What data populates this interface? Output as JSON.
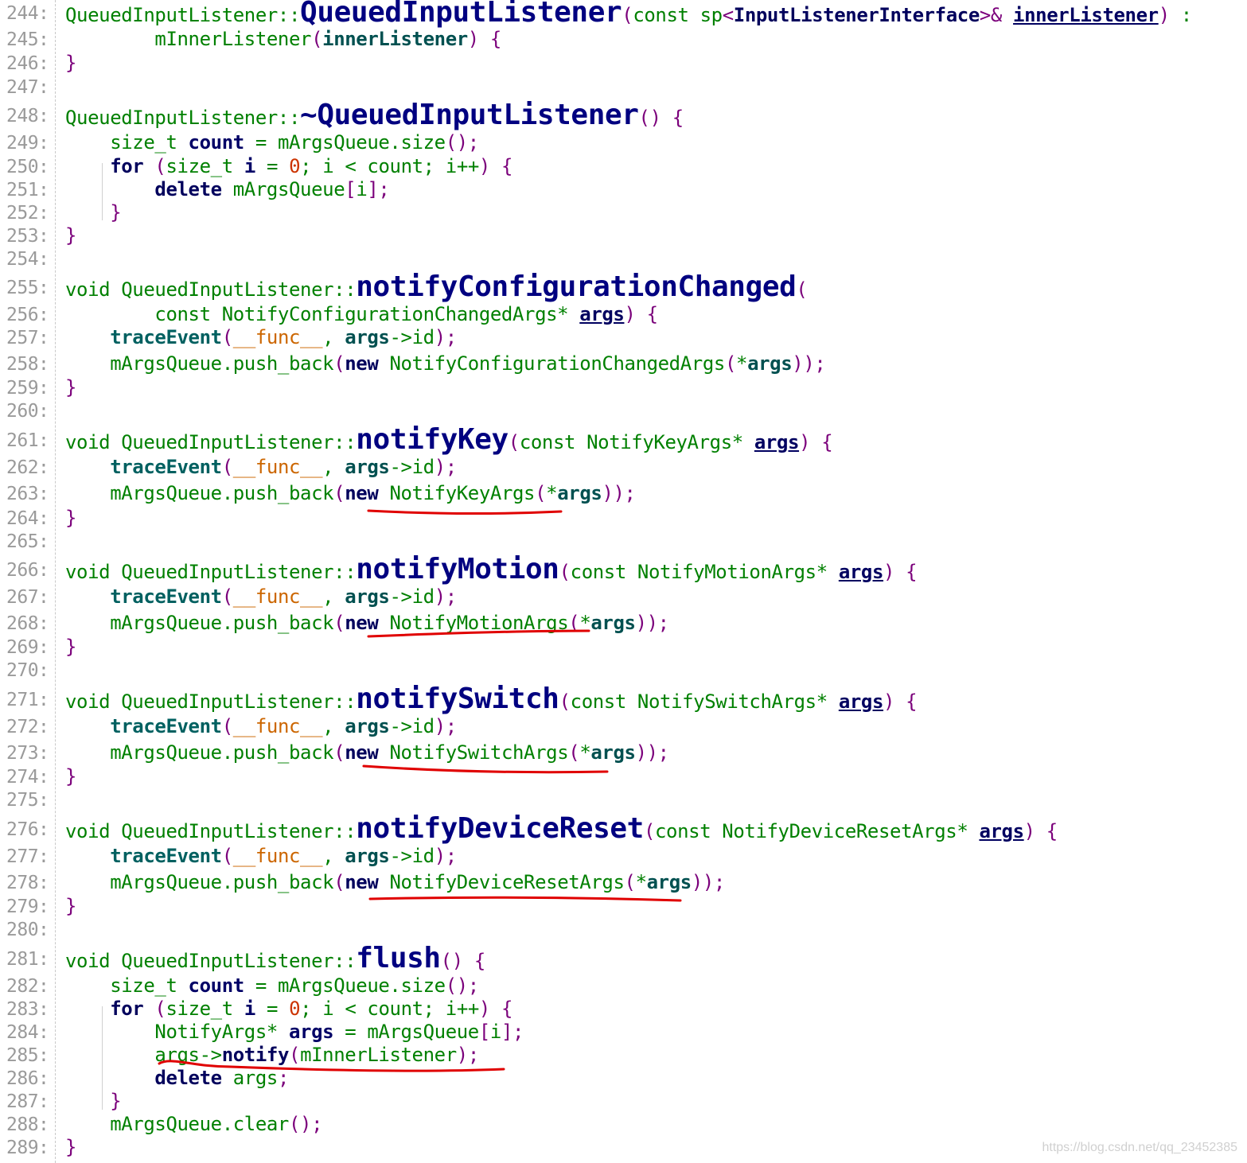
{
  "editor": {
    "lines": [
      {
        "n": "244:",
        "tokens": [
          [
            "plain",
            "QueuedInputListener::"
          ],
          [
            "defname",
            "QueuedInputListener"
          ],
          [
            "punc",
            "("
          ],
          [
            "kwlite",
            "const sp"
          ],
          [
            "punc",
            "<"
          ],
          [
            "kw",
            "InputListenerInterface"
          ],
          [
            "punc",
            ">&"
          ],
          [
            "plain",
            " "
          ],
          [
            "paramdecl",
            "innerListener"
          ],
          [
            "punc",
            ")"
          ],
          [
            "plain",
            " :"
          ]
        ]
      },
      {
        "n": "245:",
        "tokens": [
          [
            "plain",
            "        mInnerListener"
          ],
          [
            "punc",
            "("
          ],
          [
            "param",
            "innerListener"
          ],
          [
            "punc",
            ")"
          ],
          [
            "plain",
            " "
          ],
          [
            "punc",
            "{"
          ]
        ]
      },
      {
        "n": "246:",
        "tokens": [
          [
            "punc",
            "}"
          ]
        ]
      },
      {
        "n": "247:",
        "tokens": []
      },
      {
        "n": "248:",
        "tokens": [
          [
            "plain",
            "QueuedInputListener::"
          ],
          [
            "defname",
            "~QueuedInputListener"
          ],
          [
            "punc",
            "()"
          ],
          [
            "plain",
            " "
          ],
          [
            "punc",
            "{"
          ]
        ]
      },
      {
        "n": "249:",
        "tokens": [
          [
            "plain",
            "    size_t "
          ],
          [
            "var",
            "count"
          ],
          [
            "plain",
            " = mArgsQueue.size"
          ],
          [
            "punc",
            "();"
          ]
        ]
      },
      {
        "n": "250:",
        "tokens": [
          [
            "plain",
            "    "
          ],
          [
            "kw",
            "for"
          ],
          [
            "plain",
            " "
          ],
          [
            "punc",
            "("
          ],
          [
            "plain",
            "size_t "
          ],
          [
            "var",
            "i"
          ],
          [
            "plain",
            " = "
          ],
          [
            "num",
            "0"
          ],
          [
            "plain",
            "; i < count; i++"
          ],
          [
            "punc",
            ")"
          ],
          [
            "plain",
            " "
          ],
          [
            "punc",
            "{"
          ]
        ]
      },
      {
        "n": "251:",
        "tokens": [
          [
            "plain",
            "        "
          ],
          [
            "kw",
            "delete"
          ],
          [
            "plain",
            " mArgsQueue"
          ],
          [
            "punc",
            "["
          ],
          [
            "plain",
            "i"
          ],
          [
            "punc",
            "];"
          ]
        ]
      },
      {
        "n": "252:",
        "tokens": [
          [
            "plain",
            "    "
          ],
          [
            "punc",
            "}"
          ]
        ]
      },
      {
        "n": "253:",
        "tokens": [
          [
            "punc",
            "}"
          ]
        ]
      },
      {
        "n": "254:",
        "tokens": []
      },
      {
        "n": "255:",
        "tokens": [
          [
            "plain",
            "void QueuedInputListener::"
          ],
          [
            "defname",
            "notifyConfigurationChanged"
          ],
          [
            "punc",
            "("
          ]
        ]
      },
      {
        "n": "256:",
        "tokens": [
          [
            "plain",
            "        const NotifyConfigurationChangedArgs* "
          ],
          [
            "paramdecl",
            "args"
          ],
          [
            "punc",
            ")"
          ],
          [
            "plain",
            " "
          ],
          [
            "punc",
            "{"
          ]
        ]
      },
      {
        "n": "257:",
        "tokens": [
          [
            "plain",
            "    "
          ],
          [
            "call",
            "traceEvent"
          ],
          [
            "punc",
            "("
          ],
          [
            "macro",
            "__func__"
          ],
          [
            "plain",
            ", "
          ],
          [
            "param",
            "args"
          ],
          [
            "plain",
            "->id"
          ],
          [
            "punc",
            ");"
          ]
        ]
      },
      {
        "n": "258:",
        "tokens": [
          [
            "plain",
            "    mArgsQueue.push_back"
          ],
          [
            "punc",
            "("
          ],
          [
            "kw",
            "new"
          ],
          [
            "plain",
            " NotifyConfigurationChangedArgs"
          ],
          [
            "punc",
            "("
          ],
          [
            "plain",
            "*"
          ],
          [
            "param",
            "args"
          ],
          [
            "punc",
            "));"
          ]
        ]
      },
      {
        "n": "259:",
        "tokens": [
          [
            "punc",
            "}"
          ]
        ]
      },
      {
        "n": "260:",
        "tokens": []
      },
      {
        "n": "261:",
        "tokens": [
          [
            "plain",
            "void QueuedInputListener::"
          ],
          [
            "defname",
            "notifyKey"
          ],
          [
            "punc",
            "("
          ],
          [
            "plain",
            "const NotifyKeyArgs* "
          ],
          [
            "paramdecl",
            "args"
          ],
          [
            "punc",
            ")"
          ],
          [
            "plain",
            " "
          ],
          [
            "punc",
            "{"
          ]
        ]
      },
      {
        "n": "262:",
        "tokens": [
          [
            "plain",
            "    "
          ],
          [
            "call",
            "traceEvent"
          ],
          [
            "punc",
            "("
          ],
          [
            "macro",
            "__func__"
          ],
          [
            "plain",
            ", "
          ],
          [
            "param",
            "args"
          ],
          [
            "plain",
            "->id"
          ],
          [
            "punc",
            ");"
          ]
        ]
      },
      {
        "n": "263:",
        "tokens": [
          [
            "plain",
            "    mArgsQueue.push_back"
          ],
          [
            "punc",
            "("
          ],
          [
            "kw",
            "new"
          ],
          [
            "plain",
            " NotifyKeyArgs"
          ],
          [
            "punc",
            "("
          ],
          [
            "plain",
            "*"
          ],
          [
            "param",
            "args"
          ],
          [
            "punc",
            "));"
          ]
        ]
      },
      {
        "n": "264:",
        "tokens": [
          [
            "punc",
            "}"
          ]
        ]
      },
      {
        "n": "265:",
        "tokens": []
      },
      {
        "n": "266:",
        "tokens": [
          [
            "plain",
            "void QueuedInputListener::"
          ],
          [
            "defname",
            "notifyMotion"
          ],
          [
            "punc",
            "("
          ],
          [
            "plain",
            "const NotifyMotionArgs* "
          ],
          [
            "paramdecl",
            "args"
          ],
          [
            "punc",
            ")"
          ],
          [
            "plain",
            " "
          ],
          [
            "punc",
            "{"
          ]
        ]
      },
      {
        "n": "267:",
        "tokens": [
          [
            "plain",
            "    "
          ],
          [
            "call",
            "traceEvent"
          ],
          [
            "punc",
            "("
          ],
          [
            "macro",
            "__func__"
          ],
          [
            "plain",
            ", "
          ],
          [
            "param",
            "args"
          ],
          [
            "plain",
            "->id"
          ],
          [
            "punc",
            ");"
          ]
        ]
      },
      {
        "n": "268:",
        "tokens": [
          [
            "plain",
            "    mArgsQueue.push_back"
          ],
          [
            "punc",
            "("
          ],
          [
            "kw",
            "new"
          ],
          [
            "plain",
            " NotifyMotionArgs"
          ],
          [
            "punc",
            "("
          ],
          [
            "plain",
            "*"
          ],
          [
            "param",
            "args"
          ],
          [
            "punc",
            "));"
          ]
        ]
      },
      {
        "n": "269:",
        "tokens": [
          [
            "punc",
            "}"
          ]
        ]
      },
      {
        "n": "270:",
        "tokens": []
      },
      {
        "n": "271:",
        "tokens": [
          [
            "plain",
            "void QueuedInputListener::"
          ],
          [
            "defname",
            "notifySwitch"
          ],
          [
            "punc",
            "("
          ],
          [
            "plain",
            "const NotifySwitchArgs* "
          ],
          [
            "paramdecl",
            "args"
          ],
          [
            "punc",
            ")"
          ],
          [
            "plain",
            " "
          ],
          [
            "punc",
            "{"
          ]
        ]
      },
      {
        "n": "272:",
        "tokens": [
          [
            "plain",
            "    "
          ],
          [
            "call",
            "traceEvent"
          ],
          [
            "punc",
            "("
          ],
          [
            "macro",
            "__func__"
          ],
          [
            "plain",
            ", "
          ],
          [
            "param",
            "args"
          ],
          [
            "plain",
            "->id"
          ],
          [
            "punc",
            ");"
          ]
        ]
      },
      {
        "n": "273:",
        "tokens": [
          [
            "plain",
            "    mArgsQueue.push_back"
          ],
          [
            "punc",
            "("
          ],
          [
            "kw",
            "new"
          ],
          [
            "plain",
            " NotifySwitchArgs"
          ],
          [
            "punc",
            "("
          ],
          [
            "plain",
            "*"
          ],
          [
            "param",
            "args"
          ],
          [
            "punc",
            "));"
          ]
        ]
      },
      {
        "n": "274:",
        "tokens": [
          [
            "punc",
            "}"
          ]
        ]
      },
      {
        "n": "275:",
        "tokens": []
      },
      {
        "n": "276:",
        "tokens": [
          [
            "plain",
            "void QueuedInputListener::"
          ],
          [
            "defname",
            "notifyDeviceReset"
          ],
          [
            "punc",
            "("
          ],
          [
            "plain",
            "const NotifyDeviceResetArgs* "
          ],
          [
            "paramdecl",
            "args"
          ],
          [
            "punc",
            ")"
          ],
          [
            "plain",
            " "
          ],
          [
            "punc",
            "{"
          ]
        ]
      },
      {
        "n": "277:",
        "tokens": [
          [
            "plain",
            "    "
          ],
          [
            "call",
            "traceEvent"
          ],
          [
            "punc",
            "("
          ],
          [
            "macro",
            "__func__"
          ],
          [
            "plain",
            ", "
          ],
          [
            "param",
            "args"
          ],
          [
            "plain",
            "->id"
          ],
          [
            "punc",
            ");"
          ]
        ]
      },
      {
        "n": "278:",
        "tokens": [
          [
            "plain",
            "    mArgsQueue.push_back"
          ],
          [
            "punc",
            "("
          ],
          [
            "kw",
            "new"
          ],
          [
            "plain",
            " NotifyDeviceResetArgs"
          ],
          [
            "punc",
            "("
          ],
          [
            "plain",
            "*"
          ],
          [
            "param",
            "args"
          ],
          [
            "punc",
            "));"
          ]
        ]
      },
      {
        "n": "279:",
        "tokens": [
          [
            "punc",
            "}"
          ]
        ]
      },
      {
        "n": "280:",
        "tokens": []
      },
      {
        "n": "281:",
        "tokens": [
          [
            "plain",
            "void QueuedInputListener::"
          ],
          [
            "defname",
            "flush"
          ],
          [
            "punc",
            "()"
          ],
          [
            "plain",
            " "
          ],
          [
            "punc",
            "{"
          ]
        ]
      },
      {
        "n": "282:",
        "tokens": [
          [
            "plain",
            "    size_t "
          ],
          [
            "var",
            "count"
          ],
          [
            "plain",
            " = mArgsQueue.size"
          ],
          [
            "punc",
            "();"
          ]
        ]
      },
      {
        "n": "283:",
        "tokens": [
          [
            "plain",
            "    "
          ],
          [
            "kw",
            "for"
          ],
          [
            "plain",
            " "
          ],
          [
            "punc",
            "("
          ],
          [
            "plain",
            "size_t "
          ],
          [
            "var",
            "i"
          ],
          [
            "plain",
            " = "
          ],
          [
            "num",
            "0"
          ],
          [
            "plain",
            "; i < count; i++"
          ],
          [
            "punc",
            ")"
          ],
          [
            "plain",
            " "
          ],
          [
            "punc",
            "{"
          ]
        ]
      },
      {
        "n": "284:",
        "tokens": [
          [
            "plain",
            "        NotifyArgs* "
          ],
          [
            "var",
            "args"
          ],
          [
            "plain",
            " = mArgsQueue"
          ],
          [
            "punc",
            "["
          ],
          [
            "plain",
            "i"
          ],
          [
            "punc",
            "];"
          ]
        ]
      },
      {
        "n": "285:",
        "tokens": [
          [
            "plain",
            "        args->"
          ],
          [
            "kw",
            "notify"
          ],
          [
            "punc",
            "("
          ],
          [
            "plain",
            "mInnerListener"
          ],
          [
            "punc",
            ");"
          ]
        ]
      },
      {
        "n": "286:",
        "tokens": [
          [
            "plain",
            "        "
          ],
          [
            "kw",
            "delete"
          ],
          [
            "plain",
            " args"
          ],
          [
            "punc",
            ";"
          ]
        ]
      },
      {
        "n": "287:",
        "tokens": [
          [
            "plain",
            "    "
          ],
          [
            "punc",
            "}"
          ]
        ]
      },
      {
        "n": "288:",
        "tokens": [
          [
            "plain",
            "    mArgsQueue.clear"
          ],
          [
            "punc",
            "();"
          ]
        ]
      },
      {
        "n": "289:",
        "tokens": [
          [
            "punc",
            "}"
          ]
        ]
      }
    ]
  },
  "watermark": "https://blog.csdn.net/qq_23452385",
  "colors": {
    "line_number": "#9a9a9a",
    "text": "#008000",
    "keyword": "#00005c",
    "function_def": "#000080",
    "punctuation": "#7b007b",
    "number": "#cc3300",
    "macro": "#cc6600",
    "annotation": "#e00000"
  }
}
